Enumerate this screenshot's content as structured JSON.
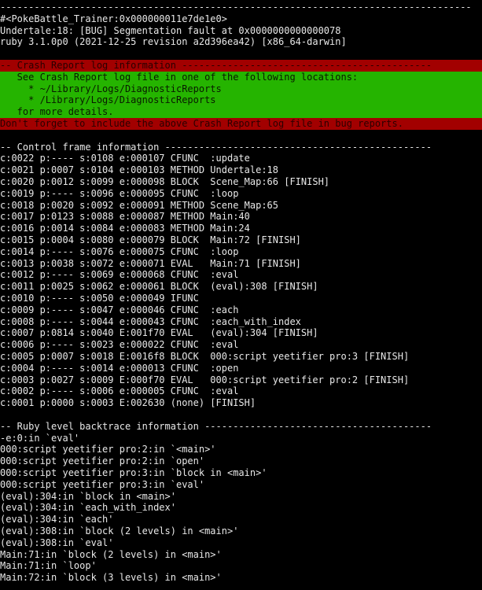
{
  "colors": {
    "background": "#000000",
    "text": "#e8e8e8",
    "report_header_bg": "#a20000",
    "report_body_bg": "#25b400"
  },
  "terminal": {
    "lines": [
      {
        "text": "-----------------------------------------------------------------------------------",
        "style": "plain"
      },
      {
        "text": "#<PokeBattle_Trainer:0x000000011e7de1e0>",
        "style": "plain"
      },
      {
        "text": "Undertale:18: [BUG] Segmentation fault at 0x0000000000000078",
        "style": "plain"
      },
      {
        "text": "ruby 3.1.0p0 (2021-12-25 revision a2d396ea42) [x86_64-darwin]",
        "style": "plain"
      },
      {
        "text": "",
        "style": "plain"
      },
      {
        "text": "-- Crash Report log information --------------------------------------------",
        "style": "red"
      },
      {
        "text": "   See Crash Report log file in one of the following locations:",
        "style": "green"
      },
      {
        "text": "     * ~/Library/Logs/DiagnosticReports",
        "style": "green"
      },
      {
        "text": "     * /Library/Logs/DiagnosticReports",
        "style": "green"
      },
      {
        "text": "   for more details.",
        "style": "green"
      },
      {
        "text": "Don't forget to include the above Crash Report log file in bug reports.",
        "style": "red"
      },
      {
        "text": "",
        "style": "plain"
      },
      {
        "text": "-- Control frame information -----------------------------------------------",
        "style": "plain"
      },
      {
        "text": "c:0022 p:---- s:0108 e:000107 CFUNC  :update",
        "style": "plain"
      },
      {
        "text": "c:0021 p:0007 s:0104 e:000103 METHOD Undertale:18",
        "style": "plain"
      },
      {
        "text": "c:0020 p:0012 s:0099 e:000098 BLOCK  Scene_Map:66 [FINISH]",
        "style": "plain"
      },
      {
        "text": "c:0019 p:---- s:0096 e:000095 CFUNC  :loop",
        "style": "plain"
      },
      {
        "text": "c:0018 p:0020 s:0092 e:000091 METHOD Scene_Map:65",
        "style": "plain"
      },
      {
        "text": "c:0017 p:0123 s:0088 e:000087 METHOD Main:40",
        "style": "plain"
      },
      {
        "text": "c:0016 p:0014 s:0084 e:000083 METHOD Main:24",
        "style": "plain"
      },
      {
        "text": "c:0015 p:0004 s:0080 e:000079 BLOCK  Main:72 [FINISH]",
        "style": "plain"
      },
      {
        "text": "c:0014 p:---- s:0076 e:000075 CFUNC  :loop",
        "style": "plain"
      },
      {
        "text": "c:0013 p:0038 s:0072 e:000071 EVAL   Main:71 [FINISH]",
        "style": "plain"
      },
      {
        "text": "c:0012 p:---- s:0069 e:000068 CFUNC  :eval",
        "style": "plain"
      },
      {
        "text": "c:0011 p:0025 s:0062 e:000061 BLOCK  (eval):308 [FINISH]",
        "style": "plain"
      },
      {
        "text": "c:0010 p:---- s:0050 e:000049 IFUNC",
        "style": "plain"
      },
      {
        "text": "c:0009 p:---- s:0047 e:000046 CFUNC  :each",
        "style": "plain"
      },
      {
        "text": "c:0008 p:---- s:0044 e:000043 CFUNC  :each_with_index",
        "style": "plain"
      },
      {
        "text": "c:0007 p:0814 s:0040 E:001f70 EVAL   (eval):304 [FINISH]",
        "style": "plain"
      },
      {
        "text": "c:0006 p:---- s:0023 e:000022 CFUNC  :eval",
        "style": "plain"
      },
      {
        "text": "c:0005 p:0007 s:0018 E:0016f8 BLOCK  000:script yeetifier pro:3 [FINISH]",
        "style": "plain"
      },
      {
        "text": "c:0004 p:---- s:0014 e:000013 CFUNC  :open",
        "style": "plain"
      },
      {
        "text": "c:0003 p:0027 s:0009 E:000f70 EVAL   000:script yeetifier pro:2 [FINISH]",
        "style": "plain"
      },
      {
        "text": "c:0002 p:---- s:0006 e:000005 CFUNC  :eval",
        "style": "plain"
      },
      {
        "text": "c:0001 p:0000 s:0003 E:002630 (none) [FINISH]",
        "style": "plain"
      },
      {
        "text": "",
        "style": "plain"
      },
      {
        "text": "-- Ruby level backtrace information ----------------------------------------",
        "style": "plain"
      },
      {
        "text": "-e:0:in `eval'",
        "style": "plain"
      },
      {
        "text": "000:script yeetifier pro:2:in `<main>'",
        "style": "plain"
      },
      {
        "text": "000:script yeetifier pro:2:in `open'",
        "style": "plain"
      },
      {
        "text": "000:script yeetifier pro:3:in `block in <main>'",
        "style": "plain"
      },
      {
        "text": "000:script yeetifier pro:3:in `eval'",
        "style": "plain"
      },
      {
        "text": "(eval):304:in `block in <main>'",
        "style": "plain"
      },
      {
        "text": "(eval):304:in `each_with_index'",
        "style": "plain"
      },
      {
        "text": "(eval):304:in `each'",
        "style": "plain"
      },
      {
        "text": "(eval):308:in `block (2 levels) in <main>'",
        "style": "plain"
      },
      {
        "text": "(eval):308:in `eval'",
        "style": "plain"
      },
      {
        "text": "Main:71:in `block (2 levels) in <main>'",
        "style": "plain"
      },
      {
        "text": "Main:71:in `loop'",
        "style": "plain"
      },
      {
        "text": "Main:72:in `block (3 levels) in <main>'",
        "style": "plain"
      }
    ]
  }
}
